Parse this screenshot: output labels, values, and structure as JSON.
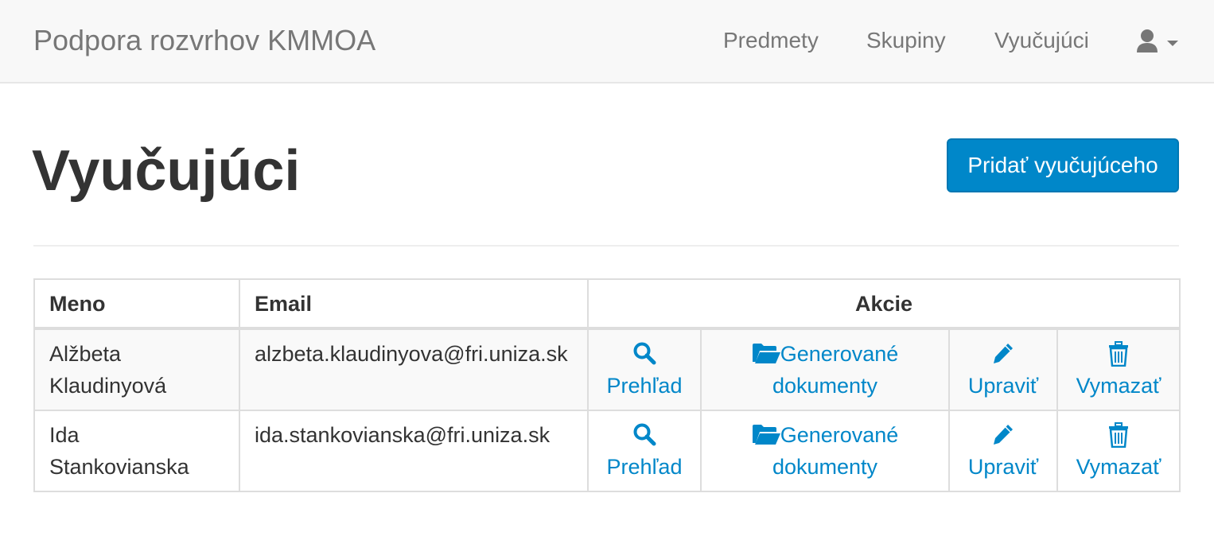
{
  "navbar": {
    "brand": "Podpora rozvrhov KMMOA",
    "links": [
      "Predmety",
      "Skupiny",
      "Vyučujúci"
    ],
    "user_icon": "user-icon",
    "caret_icon": "caret-down-icon"
  },
  "page": {
    "title": "Vyučujúci",
    "add_button_label": "Pridať vyučujúceho"
  },
  "table": {
    "headers": {
      "name": "Meno",
      "email": "Email",
      "actions": "Akcie"
    },
    "rows": [
      {
        "name_first": "Alžbeta",
        "name_last": "Klaudinyová",
        "email": "alzbeta.klaudinyova@fri.uniza.sk",
        "actions": {
          "overview": "Prehľad",
          "documents_line1": "Generované",
          "documents_line2": "dokumenty",
          "edit": "Upraviť",
          "delete": "Vymazať"
        }
      },
      {
        "name_first": "Ida",
        "name_last": "Stankovianska",
        "email": "ida.stankovianska@fri.uniza.sk",
        "actions": {
          "overview": "Prehľad",
          "documents_line1": "Generované",
          "documents_line2": "dokumenty",
          "edit": "Upraviť",
          "delete": "Vymazať"
        }
      }
    ]
  },
  "colors": {
    "accent": "#0087c9",
    "navbar_bg": "#f8f8f8",
    "nav_text": "#777777",
    "border": "#dddddd",
    "striped_row": "#f9f9f9"
  }
}
